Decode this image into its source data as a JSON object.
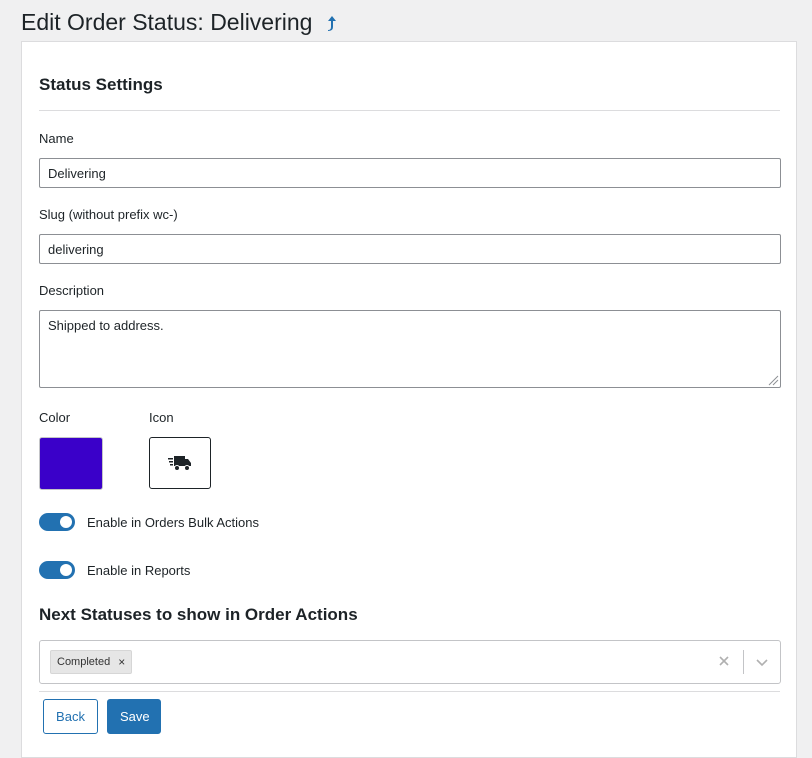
{
  "header": {
    "title": "Edit Order Status: Delivering",
    "back_icon": "arrow-up-icon"
  },
  "section": {
    "title": "Status Settings"
  },
  "fields": {
    "name_label": "Name",
    "name_value": "Delivering",
    "slug_label": "Slug (without prefix wc-)",
    "slug_value": "delivering",
    "description_label": "Description",
    "description_value": "Shipped to address.",
    "color_label": "Color",
    "color_value": "#3a00c9",
    "icon_label": "Icon",
    "icon_value": "shipping-fast-icon"
  },
  "toggles": [
    {
      "label": "Enable in Orders Bulk Actions",
      "enabled": true
    },
    {
      "label": "Enable in Reports",
      "enabled": true
    }
  ],
  "next_statuses": {
    "title": "Next Statuses to show in Order Actions",
    "selected": [
      "Completed"
    ],
    "remove_glyph": "×"
  },
  "actions": {
    "back_label": "Back",
    "save_label": "Save"
  },
  "colors": {
    "accent": "#2271b1",
    "background": "#f0f0f1",
    "swatch": "#3a00c9"
  }
}
